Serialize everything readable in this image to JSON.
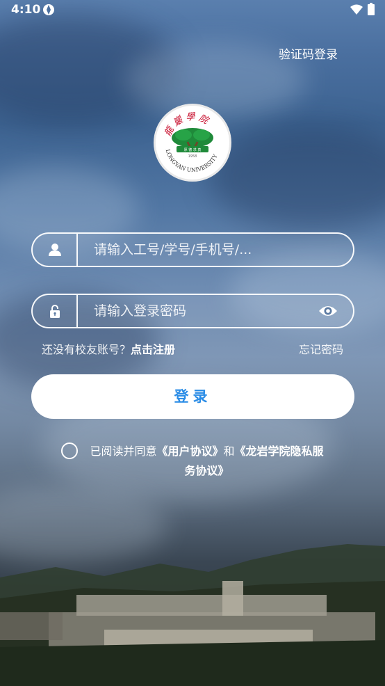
{
  "status_bar": {
    "time": "4:10"
  },
  "header": {
    "sms_login_label": "验证码登录"
  },
  "logo": {
    "calligraphy": "龍巖學院",
    "motto": "厚德 求真",
    "english": "LONGYAN UNIVERSITY",
    "year": "1958"
  },
  "form": {
    "username_placeholder": "请输入工号/学号/手机号/...",
    "password_placeholder": "请输入登录密码"
  },
  "links": {
    "register_prompt": "还没有校友账号？",
    "register_action": "点击注册",
    "forgot_password": "忘记密码"
  },
  "login_button": {
    "label": "登录"
  },
  "agreement": {
    "prefix": "已阅读并同意",
    "user_agreement": "《用户协议》",
    "connector": "和",
    "privacy_agreement": "《龙岩学院隐私服务协议》"
  },
  "colors": {
    "accent": "#2a8ce6",
    "background_sky": "#5176a3"
  }
}
